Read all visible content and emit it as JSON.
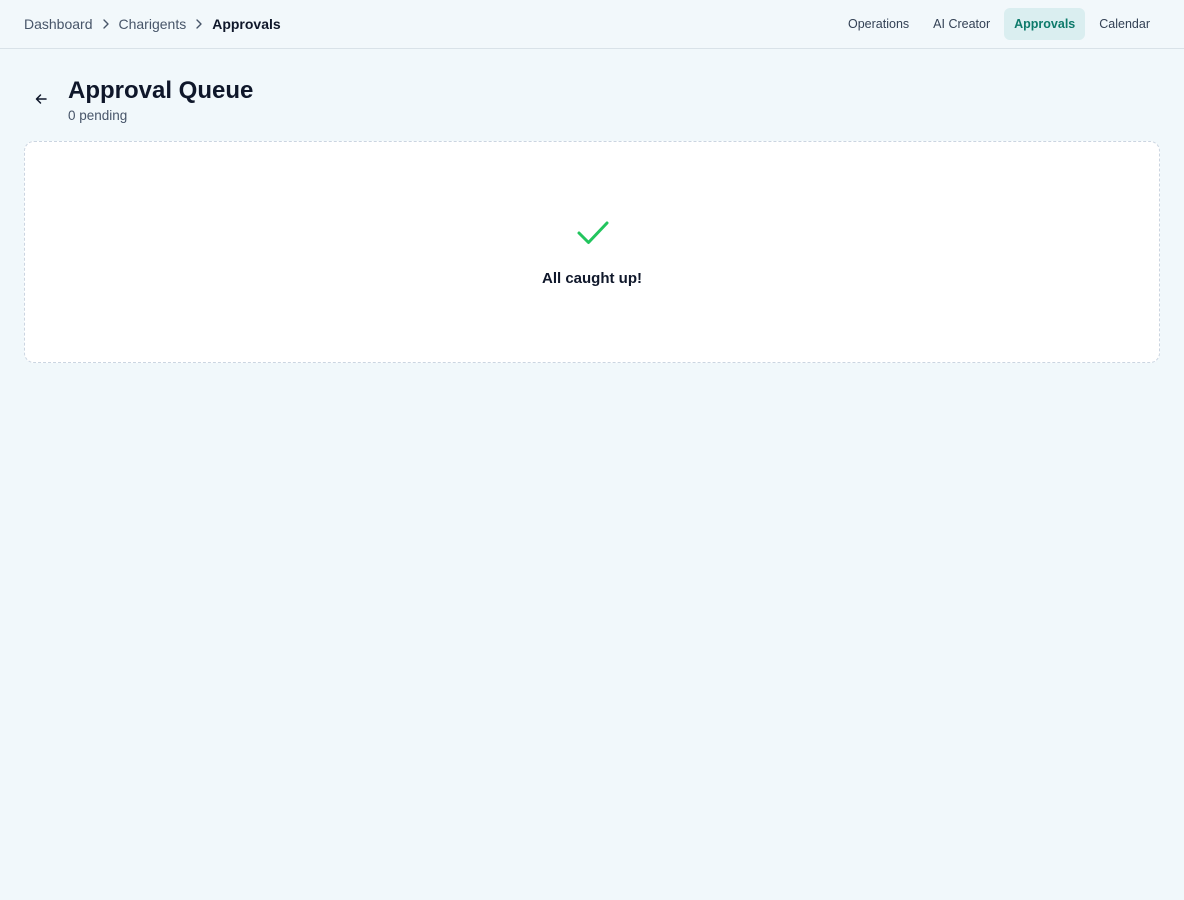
{
  "breadcrumb": {
    "items": [
      {
        "label": "Dashboard"
      },
      {
        "label": "Charigents"
      },
      {
        "label": "Approvals"
      }
    ]
  },
  "nav": {
    "items": [
      {
        "label": "Operations"
      },
      {
        "label": "AI Creator"
      },
      {
        "label": "Approvals",
        "active": true
      },
      {
        "label": "Calendar"
      }
    ]
  },
  "header": {
    "title": "Approval Queue",
    "subtitle": "0 pending"
  },
  "empty_state": {
    "icon": "check-icon",
    "message": "All caught up!"
  },
  "colors": {
    "accent": "#0d7a6b",
    "success": "#22c55e",
    "background": "#f1f8fb"
  }
}
